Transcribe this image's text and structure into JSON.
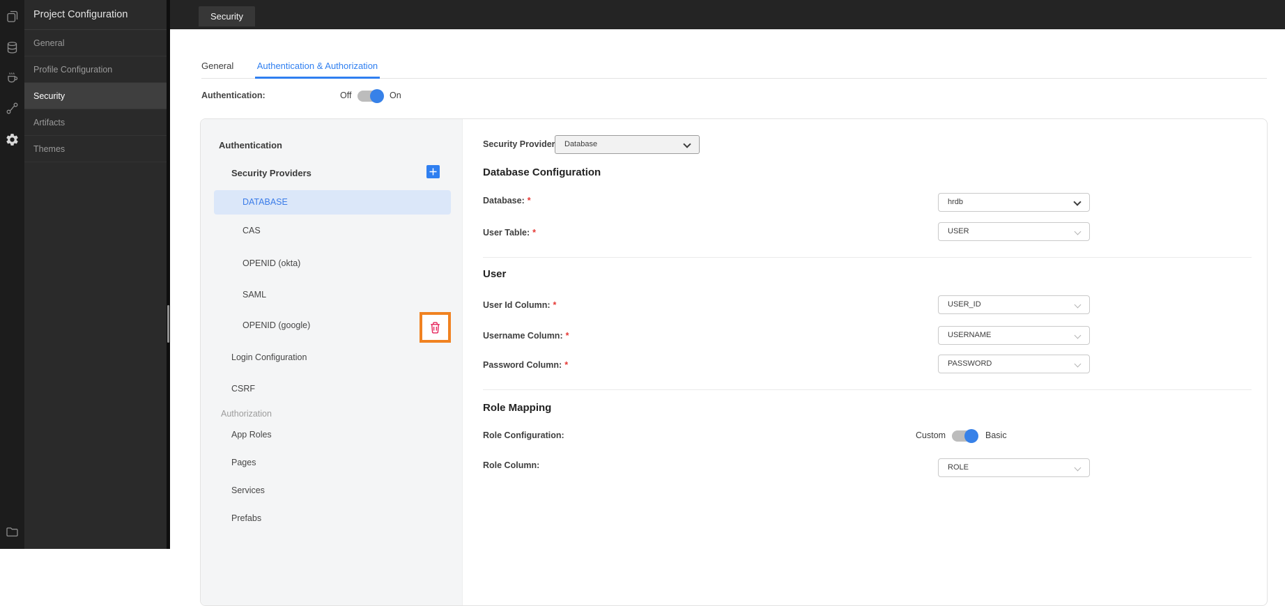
{
  "colors": {
    "accent_blue": "#2f7ff0",
    "selected_row_bg": "#dbe7f9",
    "delete_red": "#e5235a",
    "highlight_orange": "#f08221"
  },
  "rail": {
    "icons": [
      "pages",
      "database",
      "java-service",
      "workflow",
      "settings"
    ],
    "bottom_icon": "folder"
  },
  "sidebar": {
    "title": "Project Configuration",
    "items": [
      {
        "label": "General",
        "active": false
      },
      {
        "label": "Profile Configuration",
        "active": false
      },
      {
        "label": "Security",
        "active": true
      },
      {
        "label": "Artifacts",
        "active": false
      },
      {
        "label": "Themes",
        "active": false
      }
    ]
  },
  "topbar": {
    "tab": "Security"
  },
  "tabs": {
    "general": "General",
    "auth": "Authentication & Authorization"
  },
  "auth_row": {
    "label": "Authentication:",
    "off": "Off",
    "on": "On",
    "state": "On"
  },
  "panel": {
    "auth_header": "Authentication",
    "providers_header": "Security Providers",
    "providers": {
      "selected": "DATABASE",
      "others": [
        "CAS",
        "OPENID (okta)",
        "SAML",
        "OPENID (google)"
      ]
    },
    "login_configuration": "Login Configuration",
    "csrf": "CSRF",
    "authorization_header": "Authorization",
    "authorization_items": [
      "App Roles",
      "Pages",
      "Services",
      "Prefabs"
    ]
  },
  "form": {
    "required_marker": "*",
    "security_provider": {
      "label": "Security Provider",
      "value": "Database"
    },
    "database_config": {
      "title": "Database Configuration",
      "database": {
        "label": "Database:",
        "value": "hrdb"
      },
      "user_table": {
        "label": "User Table:",
        "value": "USER"
      }
    },
    "user": {
      "title": "User",
      "user_id": {
        "label": "User Id Column:",
        "value": "USER_ID"
      },
      "username": {
        "label": "Username Column:",
        "value": "USERNAME"
      },
      "password": {
        "label": "Password Column:",
        "value": "PASSWORD"
      }
    },
    "role_mapping": {
      "title": "Role Mapping",
      "role_configuration": {
        "label": "Role Configuration:",
        "left": "Custom",
        "right": "Basic",
        "state": "Basic"
      },
      "role_column": {
        "label": "Role Column:",
        "value": "ROLE"
      }
    }
  }
}
